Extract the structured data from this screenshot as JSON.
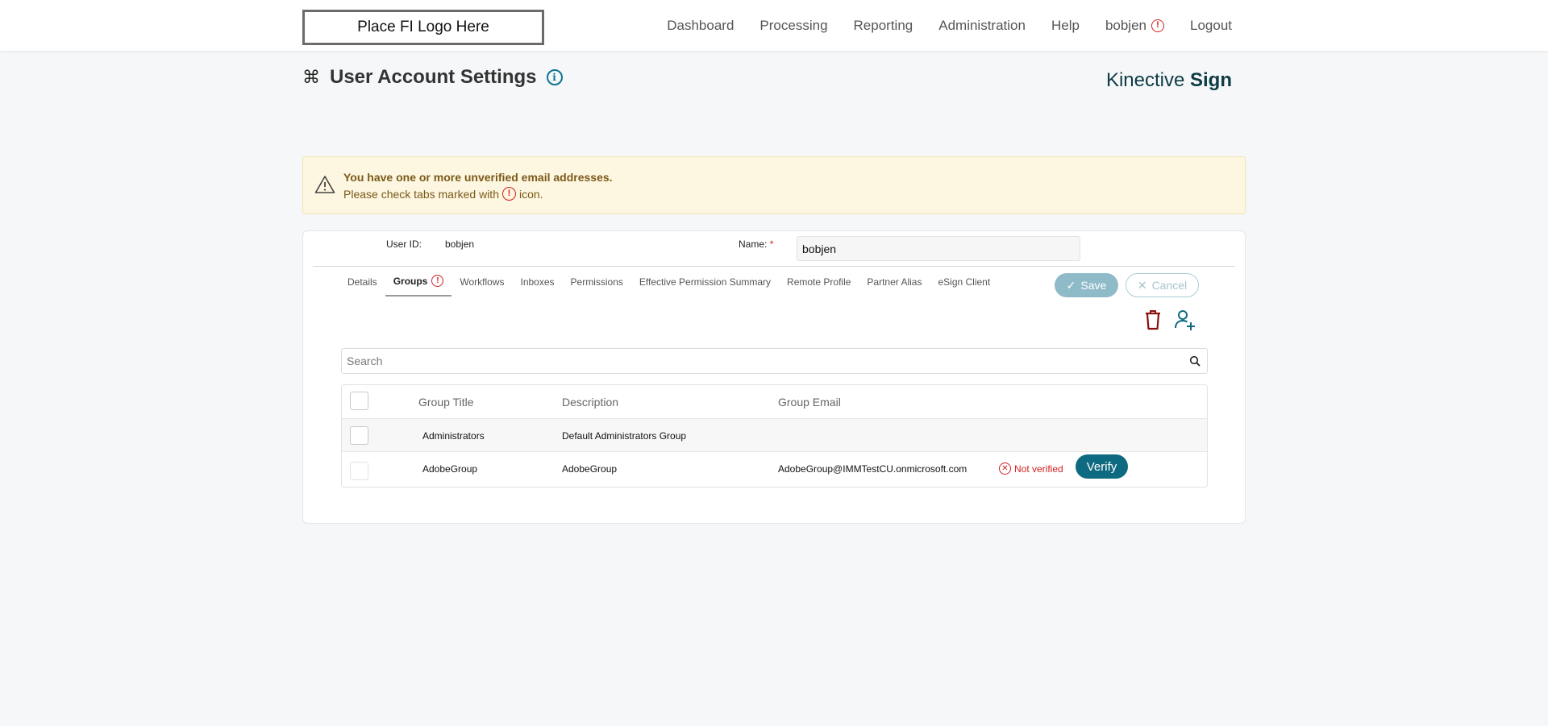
{
  "topbar": {
    "logo_text": "Place FI Logo Here",
    "nav": [
      {
        "label": "Dashboard"
      },
      {
        "label": "Processing"
      },
      {
        "label": "Reporting"
      },
      {
        "label": "Administration"
      },
      {
        "label": "Help"
      },
      {
        "label": "bobjen",
        "icon": "exclamation-circle-icon"
      },
      {
        "label": "Logout"
      }
    ]
  },
  "header": {
    "title": "User Account Settings",
    "brand_light": "Kinective ",
    "brand_bold": "Sign"
  },
  "alert": {
    "title": "You have one or more unverified email addresses.",
    "msg_before": "Please check tabs marked with",
    "msg_after": "icon."
  },
  "form": {
    "user_id_label": "User ID:",
    "user_id_value": "bobjen",
    "name_label": "Name:",
    "name_required": "*",
    "name_value": "bobjen"
  },
  "tabs": [
    {
      "label": "Details"
    },
    {
      "label": "Groups",
      "active": true,
      "warning": true
    },
    {
      "label": "Workflows"
    },
    {
      "label": "Inboxes"
    },
    {
      "label": "Permissions"
    },
    {
      "label": "Effective Permission Summary"
    },
    {
      "label": "Remote Profile"
    },
    {
      "label": "Partner Alias"
    },
    {
      "label": "eSign Client"
    }
  ],
  "actions": {
    "save_label": "Save",
    "cancel_label": "Cancel"
  },
  "search": {
    "placeholder": "Search"
  },
  "table": {
    "headers": {
      "title": "Group Title",
      "description": "Description",
      "email": "Group Email"
    },
    "rows": [
      {
        "title": "Administrators",
        "description": "Default Administrators Group",
        "email": "",
        "status": "",
        "action": ""
      },
      {
        "title": "AdobeGroup",
        "description": "AdobeGroup",
        "email": "AdobeGroup@IMMTestCU.onmicrosoft.com",
        "status": "Not verified",
        "action": "Verify"
      }
    ]
  },
  "colors": {
    "accent": "#0e6a80",
    "warning": "#d32020",
    "alert_bg": "#fdf6e0"
  }
}
